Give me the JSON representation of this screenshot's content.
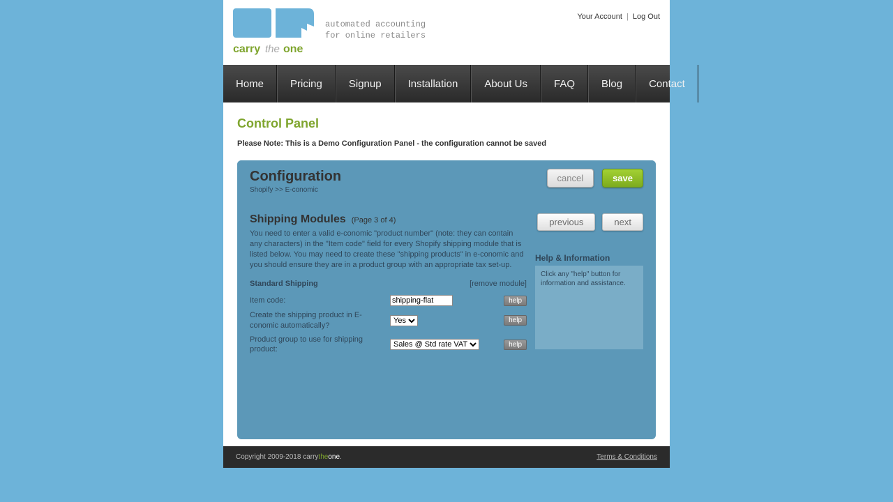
{
  "header": {
    "tagline_line1": "automated accounting",
    "tagline_line2": "for online retailers",
    "your_account": "Your Account",
    "log_out": "Log Out",
    "brand_carry": "carry",
    "brand_the": "the",
    "brand_one": "one"
  },
  "nav": {
    "home": "Home",
    "pricing": "Pricing",
    "signup": "Signup",
    "installation": "Installation",
    "about": "About Us",
    "faq": "FAQ",
    "blog": "Blog",
    "contact": "Contact"
  },
  "content": {
    "control_panel": "Control Panel",
    "demo_note": "Please Note: This is a Demo Configuration Panel - the configuration cannot be saved"
  },
  "config": {
    "title": "Configuration",
    "breadcrumb": "Shopify >> E-conomic",
    "cancel": "cancel",
    "save": "save",
    "previous": "previous",
    "next": "next",
    "section_title": "Shipping Modules",
    "page_indicator": "(Page 3 of 4)",
    "description": "You need to enter a valid e-conomic \"product number\" (note: they can contain any characters) in the \"Item code\" field for every Shopify shipping module that is listed below. You may need to create these \"shipping products\" in e-conomic and you should ensure they are in a product group with an appropriate tax set-up.",
    "module_name": "Standard Shipping",
    "remove_module": "[remove module]",
    "item_code_label": "Item code:",
    "item_code_value": "shipping-flat",
    "auto_create_label": "Create the shipping product in E-conomic automatically?",
    "auto_create_value": "Yes",
    "product_group_label": "Product group to use for shipping product:",
    "product_group_value": "Sales @ Std rate VAT",
    "help_btn": "help"
  },
  "help": {
    "title": "Help & Information",
    "text": "Click any \"help\" button for information and assistance."
  },
  "footer": {
    "copyright": "Copyright 2009-2018 ",
    "brand_carry": "carry",
    "brand_the": "the",
    "brand_one": "one",
    "period": ".",
    "terms": "Terms & Conditions"
  }
}
